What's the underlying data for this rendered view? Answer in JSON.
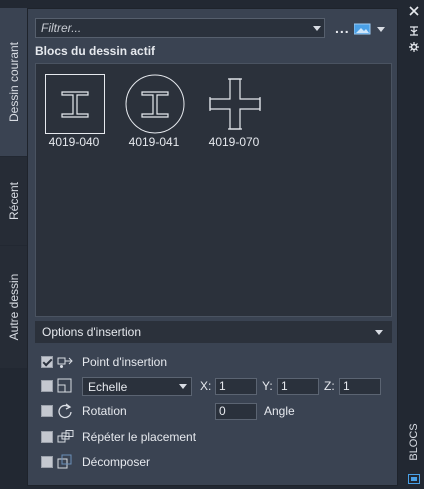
{
  "tabs": [
    {
      "label": "Dessin courant"
    },
    {
      "label": "Récent"
    },
    {
      "label": "Autre dessin"
    }
  ],
  "filter": {
    "placeholder": "Filtrer...",
    "more_label": "..."
  },
  "section_title": "Blocs du dessin actif",
  "blocks": [
    {
      "name": "4019-040"
    },
    {
      "name": "4019-041"
    },
    {
      "name": "4019-070"
    }
  ],
  "options": {
    "header": "Options d'insertion",
    "insertion_point": {
      "label": "Point d'insertion",
      "checked": true
    },
    "scale": {
      "mode": "Echelle",
      "x_label": "X:",
      "x": "1",
      "y_label": "Y:",
      "y": "1",
      "z_label": "Z:",
      "z": "1",
      "checked": false
    },
    "rotation": {
      "label": "Rotation",
      "value": "0",
      "angle_label": "Angle",
      "checked": false
    },
    "repeat": {
      "label": "Répéter le placement",
      "checked": false
    },
    "explode": {
      "label": "Décomposer",
      "checked": false
    }
  },
  "palette_name": "BLOCS",
  "colors": {
    "panel": "#3a4352",
    "well": "#2b313b",
    "accent": "#4aa0e6"
  }
}
